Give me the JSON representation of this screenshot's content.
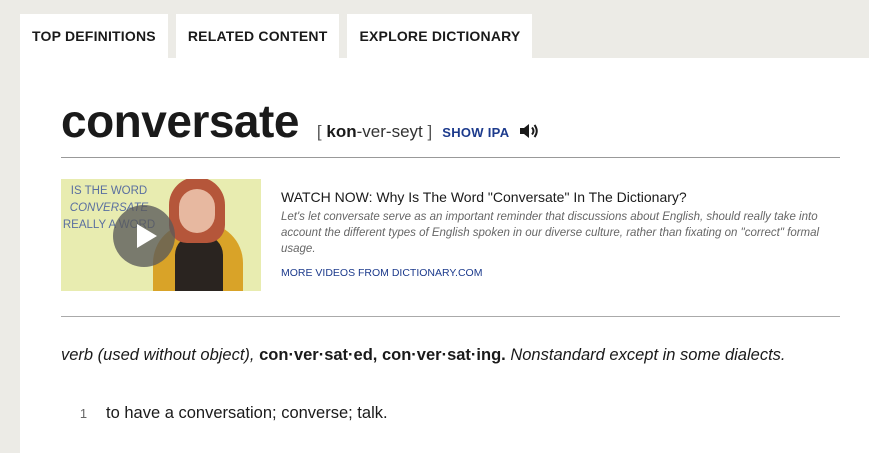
{
  "tabs": [
    "TOP DEFINITIONS",
    "RELATED CONTENT",
    "EXPLORE DICTIONARY"
  ],
  "entry": {
    "headword": "conversate",
    "pron_open": "[",
    "pron_stress": "kon",
    "pron_rest": "-ver-seyt",
    "pron_close": "]",
    "show_ipa": "SHOW IPA",
    "speaker_icon": "speaker-icon"
  },
  "video": {
    "thumb_line1": "IS THE WORD",
    "thumb_line2": "CONVERSATE",
    "thumb_line3": "REALLY A WORD",
    "title": "WATCH NOW: Why Is The Word \"Conversate\" In The Dictionary?",
    "description": "Let's let conversate serve as an important reminder that discussions about English, should really take into account the different types of English spoken in our diverse culture, rather than fixating on \"correct\" formal usage.",
    "more_link": "MORE VIDEOS FROM DICTIONARY.COM"
  },
  "definition": {
    "pos": "verb (used without object),",
    "forms": "con·ver·sat·ed, con·ver·sat·ing.",
    "note": "Nonstandard except in some dialects.",
    "senses": [
      {
        "number": "1",
        "text": "to have a conversation; converse; talk."
      }
    ]
  }
}
